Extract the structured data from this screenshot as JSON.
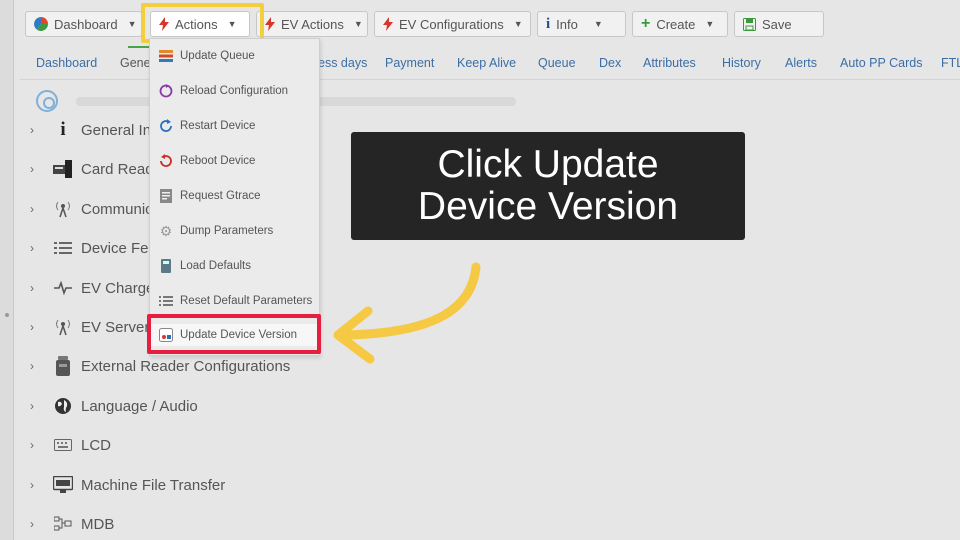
{
  "toolbar": {
    "dashboard": "Dashboard",
    "actions": "Actions",
    "ev_actions": "EV Actions",
    "ev_configurations": "EV Configurations",
    "info": "Info",
    "create": "Create",
    "save": "Save"
  },
  "tabs": [
    "Dashboard",
    "Gene",
    "ess days",
    "Payment",
    "Keep Alive",
    "Queue",
    "Dex",
    "Attributes",
    "History",
    "Alerts",
    "Auto PP Cards",
    "FTL"
  ],
  "tree": [
    {
      "label": "General Inf",
      "icon": "info-icon"
    },
    {
      "label": "Card Reade",
      "icon": "card-reader-icon"
    },
    {
      "label": "Communic",
      "icon": "antenna-icon"
    },
    {
      "label": "Device Fea",
      "icon": "list-icon"
    },
    {
      "label": "EV Charger",
      "icon": "pulse-icon"
    },
    {
      "label": "EV Server",
      "icon": "antenna-icon"
    },
    {
      "label": "External Reader Configurations",
      "icon": "reader-icon"
    },
    {
      "label": "Language / Audio",
      "icon": "globe-icon"
    },
    {
      "label": "LCD",
      "icon": "keyboard-icon"
    },
    {
      "label": "Machine File Transfer",
      "icon": "ftp-icon"
    },
    {
      "label": "MDB",
      "icon": "network-icon"
    }
  ],
  "actions_menu": [
    {
      "label": "Update Queue",
      "icon": "queue-icon"
    },
    {
      "label": "Reload Configuration",
      "icon": "reload-icon"
    },
    {
      "label": "Restart Device",
      "icon": "restart-icon"
    },
    {
      "label": "Reboot Device",
      "icon": "reboot-icon"
    },
    {
      "label": "Request Gtrace",
      "icon": "gtrace-icon"
    },
    {
      "label": "Dump Parameters",
      "icon": "gear-icon"
    },
    {
      "label": "Load Defaults",
      "icon": "load-icon"
    },
    {
      "label": "Reset Default Parameters",
      "icon": "list-icon"
    },
    {
      "label": "Update Device Version",
      "icon": "device-version-icon"
    }
  ],
  "callout": {
    "line1": "Click Update",
    "line2": "Device Version"
  },
  "colors": {
    "highlight_yellow": "#f3cf3e",
    "highlight_red": "#e51f3d",
    "arrow": "#f6c944",
    "link": "#3b6ea5",
    "callout_bg": "#252525"
  }
}
